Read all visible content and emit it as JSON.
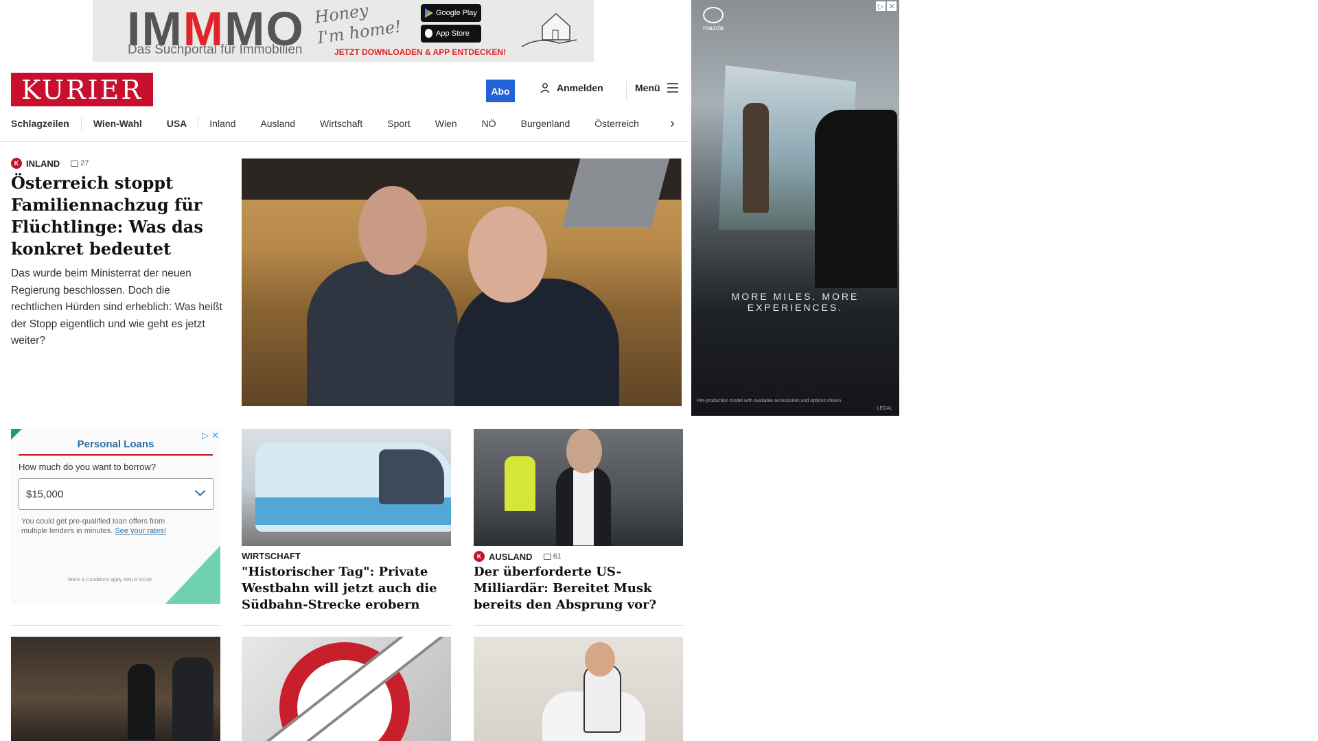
{
  "top_ad": {
    "brand_a": "IM",
    "brand_b": "M",
    "brand_c": "MO",
    "tagline": "Das Suchportal für Immobilien",
    "script_line1": "Honey",
    "script_line2": "I'm home!",
    "google_play": "Google Play",
    "app_store": "App Store",
    "cta": "JETZT DOWNLOADEN & APP ENTDECKEN!"
  },
  "header": {
    "logo": "KURIER",
    "abo": "Abo",
    "login": "Anmelden",
    "menu": "Menü"
  },
  "nav": {
    "items": [
      "Schlagzeilen",
      "Wien-Wahl",
      "USA",
      "Inland",
      "Ausland",
      "Wirtschaft",
      "Sport",
      "Wien",
      "NÖ",
      "Burgenland",
      "Österreich"
    ]
  },
  "side_ad": {
    "brand": "mazda",
    "headline_1": "MORE MILES. MORE",
    "headline_2": "EXPERIENCES.",
    "fine_print": "Pre-production model with available accessories and options shown.",
    "legal": "LEGAL"
  },
  "lead": {
    "badge": "K",
    "category": "INLAND",
    "comments": "27",
    "title": "Österreich stoppt Familiennachzug für Flüchtlinge: Was das konkret bedeutet",
    "teaser": "Das wurde beim Ministerrat der neuen Regierung beschlossen. Doch die rechtlichen Hürden sind erheblich: Was heißt der Stopp eigentlich und wie geht es jetzt weiter?"
  },
  "loan_ad": {
    "title": "Personal Loans",
    "question": "How much do you want to borrow?",
    "amount": "$15,000",
    "note": "You could get pre-qualified loan offers from multiple lenders in minutes.",
    "link": "See your rates!",
    "terms": "Terms & Conditions apply. NMLS #1136"
  },
  "cards": [
    {
      "category": "WIRTSCHAFT",
      "title": "\"Historischer Tag\": Private Westbahn will jetzt auch die Südbahn-Strecke erobern"
    },
    {
      "badge": "K",
      "category": "AUSLAND",
      "comments": "61",
      "title": "Der überforderte US-Milliardär: Bereitet Musk bereits den Absprung vor?"
    }
  ],
  "colors": {
    "brand_red": "#c8102e",
    "abo_blue": "#2262d6"
  }
}
